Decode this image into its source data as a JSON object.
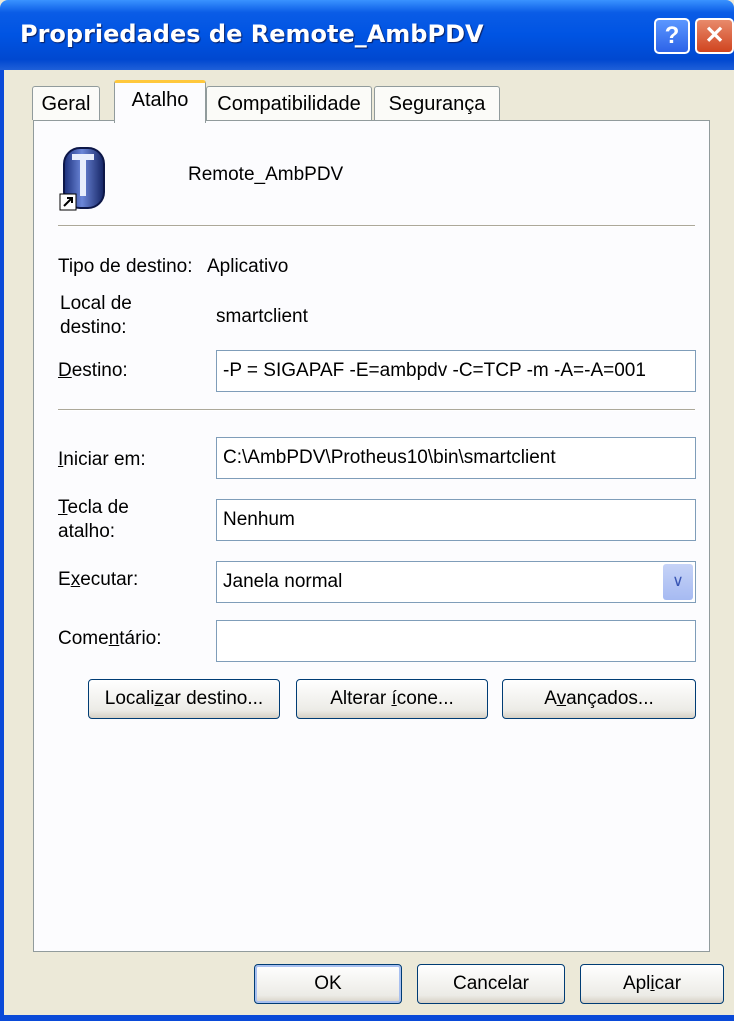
{
  "window": {
    "title": "Propriedades de Remote_AmbPDV",
    "help_label": "?",
    "close_label": "✕"
  },
  "tabs": [
    {
      "label": "Geral"
    },
    {
      "label": "Atalho"
    },
    {
      "label": "Compatibilidade"
    },
    {
      "label": "Segurança"
    }
  ],
  "shortcut": {
    "name": "Remote_AmbPDV",
    "icon": "shortcut-app-icon"
  },
  "fields": {
    "target_type_label": "Tipo de destino:",
    "target_type_value": "Aplicativo",
    "target_location_label_line1": "Local de",
    "target_location_label_line2": "destino:",
    "target_location_value": "smartclient",
    "target_label_pre": "",
    "target_label_key": "D",
    "target_label_post": "estino:",
    "target_value": "-P = SIGAPAF -E=ambpdv -C=TCP -m -A=-A=001",
    "start_in_label_key": "I",
    "start_in_label_post": "niciar em:",
    "start_in_value": "C:\\AmbPDV\\Protheus10\\bin\\smartclient",
    "hotkey_label_key": "T",
    "hotkey_label_post": "ecla de",
    "hotkey_label_line2": "atalho:",
    "hotkey_value": "Nenhum",
    "run_label_pre": "E",
    "run_label_key": "x",
    "run_label_post": "ecutar:",
    "run_value": "Janela normal",
    "comment_label_pre": "Come",
    "comment_label_key": "n",
    "comment_label_post": "tário:",
    "comment_value": ""
  },
  "buttons": {
    "find_target_pre": "Locali",
    "find_target_key": "z",
    "find_target_post": "ar destino...",
    "change_icon_pre": "Alterar ",
    "change_icon_key": "í",
    "change_icon_post": "cone...",
    "advanced_pre": "A",
    "advanced_key": "v",
    "advanced_post": "ançados...",
    "ok": "OK",
    "cancel": "Cancelar",
    "apply_pre": "Apl",
    "apply_key": "i",
    "apply_post": "car"
  },
  "colors": {
    "titlebar": "#0054e3",
    "dialog_bg": "#ece9d8",
    "tab_highlight": "#ffc83c"
  }
}
